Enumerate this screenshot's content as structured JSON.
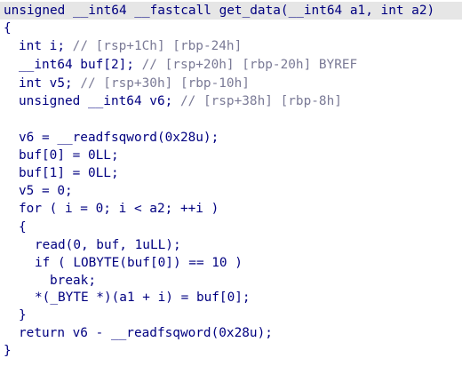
{
  "code": {
    "signature": "unsigned __int64 __fastcall get_data(__int64 a1, int a2)",
    "open_brace": "{",
    "decl_i": {
      "code": "int i; ",
      "comment": "// [rsp+1Ch] [rbp-24h]"
    },
    "decl_buf": {
      "code": "__int64 buf[2]; ",
      "comment": "// [rsp+20h] [rbp-20h] BYREF"
    },
    "decl_v5": {
      "code": "int v5; ",
      "comment": "// [rsp+30h] [rbp-10h]"
    },
    "decl_v6": {
      "code": "unsigned __int64 v6; ",
      "comment": "// [rsp+38h] [rbp-8h]"
    },
    "stmt_v6": "v6 = __readfsqword(0x28u);",
    "stmt_buf0": "buf[0] = 0LL;",
    "stmt_buf1": "buf[1] = 0LL;",
    "stmt_v5": "v5 = 0;",
    "for_line": "for ( i = 0; i < a2; ++i )",
    "for_open": "{",
    "read_call": "read(0, buf, 1uLL);",
    "if_line": "if ( LOBYTE(buf[0]) == 10 )",
    "break_stmt": "break;",
    "assign_stmt": "*(_BYTE *)(a1 + i) = buf[0];",
    "for_close": "}",
    "return_stmt": "return v6 - __readfsqword(0x28u);",
    "close_brace": "}"
  },
  "colors": {
    "code_text": "#000080",
    "comment_text": "#7a7a96",
    "signature_bg": "#e6e6e6",
    "background": "#ffffff"
  }
}
